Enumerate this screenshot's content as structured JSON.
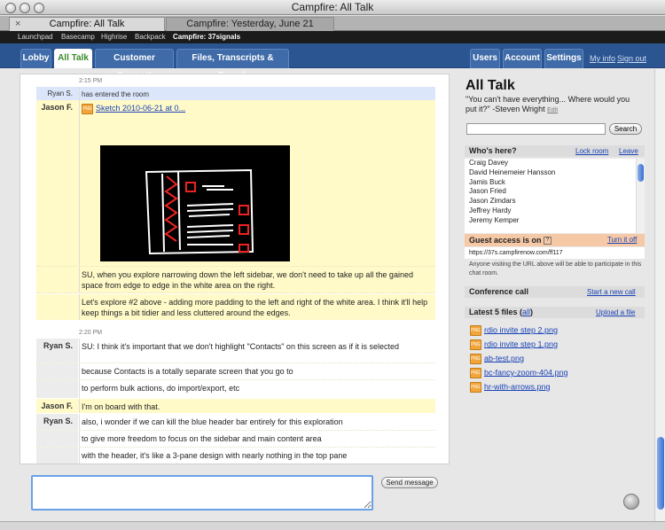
{
  "window": {
    "title": "Campfire: All Talk"
  },
  "browser_tabs": [
    {
      "label": "Campfire: All Talk"
    },
    {
      "label": "Campfire: Yesterday, June 21"
    }
  ],
  "top_links": [
    "Launchpad",
    "Basecamp",
    "Highrise",
    "Backpack",
    "Campfire: 37signals"
  ],
  "nav": {
    "tabs": [
      "Lobby",
      "All Talk",
      "Customer Support",
      "Files, Transcripts & Search"
    ],
    "right": [
      "Users",
      "Account",
      "Settings"
    ],
    "links": [
      "My info",
      "Sign out"
    ]
  },
  "chat": {
    "time1": "2:15 PM",
    "enter": {
      "who": "Ryan S.",
      "text": "has entered the room"
    },
    "jason1": {
      "who": "Jason F.",
      "file": "Sketch 2010-06-21 at 0..."
    },
    "jason_lines": [
      "SU, when you explore narrowing down the left sidebar, we don't need to take up all the gained space from edge to edge in the white area on the right.",
      "Let's explore #2 above - adding more padding to the left and right of the white area. I think it'll help keep things a bit tidier and less cluttered around the edges."
    ],
    "time2": "2:20 PM",
    "ryan1": {
      "who": "Ryan S.",
      "lines": [
        "SU: I think it's important that we don't highlight \"Contacts\" on this screen as if it is selected",
        "because Contacts is a totally separate screen that you go to",
        "to perform bulk actions, do import/export, etc"
      ]
    },
    "jason2": {
      "who": "Jason F.",
      "text": "I'm on board with that."
    },
    "ryan2": {
      "who": "Ryan S.",
      "lines": [
        "also, i wonder if we can kill the blue header bar entirely for this exploration",
        "to give more freedom to focus on the sidebar and main content area",
        "with the header, it's like a 3-pane design with nearly nothing in the top pane"
      ]
    },
    "send": "Send message",
    "input_value": ""
  },
  "sidebar": {
    "title": "All Talk",
    "quote": "\"You can't have everything... Where would you put it?\" -Steven Wright",
    "edit": "Edit",
    "search_button": "Search",
    "whos_here": "Who's here?",
    "lock_room": "Lock room",
    "leave": "Leave",
    "people": [
      "Craig Davey",
      "David Heinemeier Hansson",
      "Jamis Buck",
      "Jason Fried",
      "Jason Zimdars",
      "Jeffrey Hardy",
      "Jeremy Kemper"
    ],
    "guest_access": "Guest access is on",
    "guest_q": "?",
    "turn_off": "Turn it off",
    "guest_url": "https://37s.campfirenow.com/ff117",
    "guest_note": "Anyone visiting the URL above will be able to participate in this chat room.",
    "conference": "Conference call",
    "start_call": "Start a new call",
    "latest_files_prefix": "Latest 5 files (",
    "latest_files_all": "all",
    "latest_files_suffix": ")",
    "upload": "Upload a file",
    "files": [
      "rdio invite step 2.png",
      "rdio invite step 1.png",
      "ab-test.png",
      "bc-fancy-zoom-404.png",
      "hr-with-arrows.png"
    ]
  },
  "icons": {
    "file": "png-file-icon",
    "sound": "sound-icon"
  }
}
